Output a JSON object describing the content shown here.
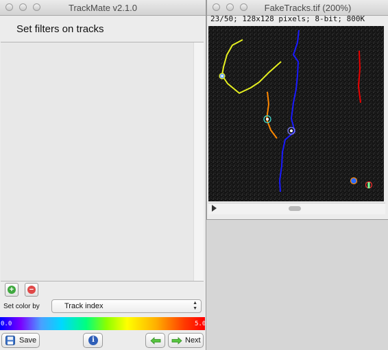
{
  "trackmate": {
    "title": "TrackMate v2.1.0",
    "heading": "Set filters on tracks",
    "add_glyph": "+",
    "remove_glyph": "−",
    "color_by_label": "Set color by",
    "color_by_value": "Track index",
    "gradient_min": "0.0",
    "gradient_max": "5.0",
    "save_label": "Save",
    "info_glyph": "i",
    "next_label": "Next"
  },
  "image_window": {
    "title": "FakeTracks.tif (200%)",
    "info": "23/50; 128x128 pixels; 8-bit; 800K"
  },
  "colors": {
    "track_yellow": "#e6f020",
    "track_blue": "#1a1aff",
    "track_orange": "#ff8800",
    "track_red": "#ee0000"
  }
}
